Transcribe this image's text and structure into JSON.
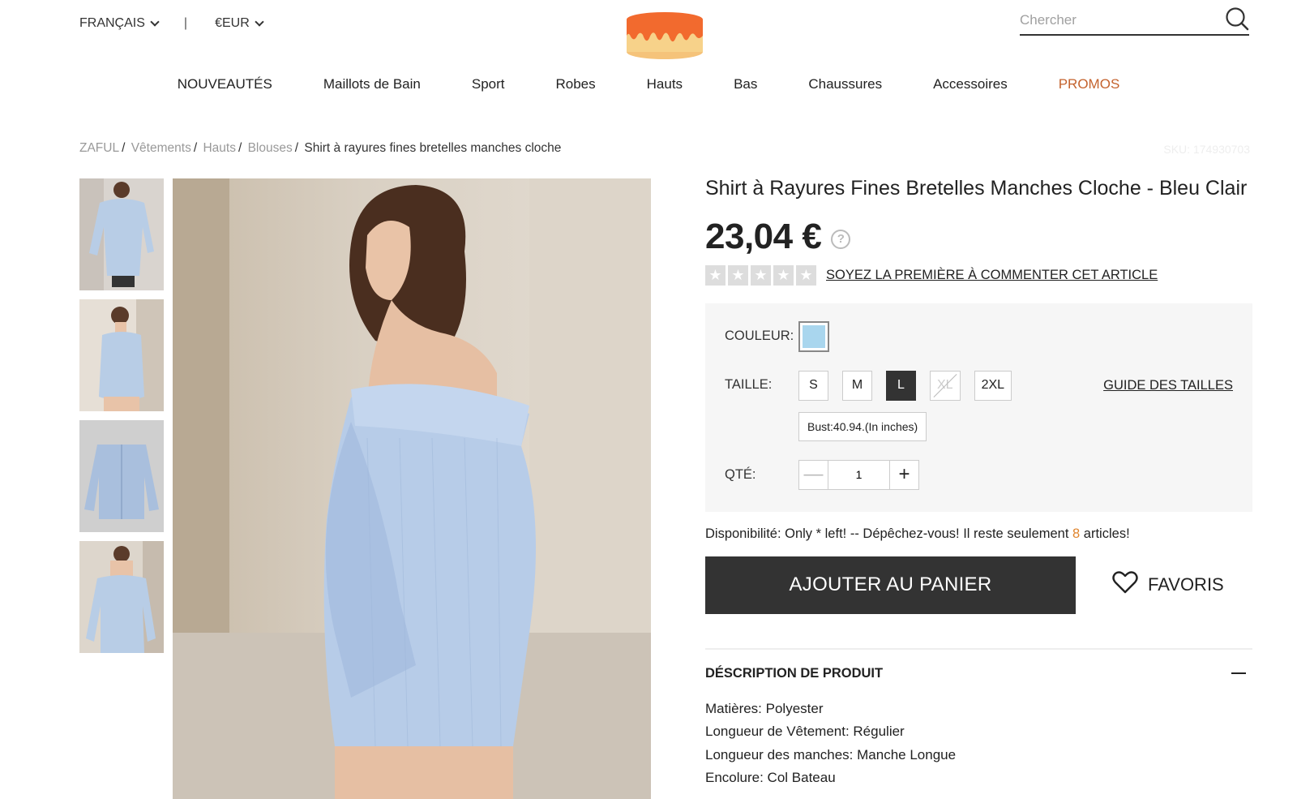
{
  "header": {
    "language_label": "FRANÇAIS",
    "separator": "|",
    "currency_label": "€EUR",
    "search_placeholder": "Chercher"
  },
  "nav": {
    "items": [
      {
        "label": "NOUVEAUTÉS"
      },
      {
        "label": "Maillots de Bain"
      },
      {
        "label": "Sport"
      },
      {
        "label": "Robes"
      },
      {
        "label": "Hauts"
      },
      {
        "label": "Bas"
      },
      {
        "label": "Chaussures"
      },
      {
        "label": "Accessoires"
      },
      {
        "label": "PROMOS",
        "color": "#c4622d"
      }
    ]
  },
  "breadcrumb": {
    "items": [
      "ZAFUL",
      "Vêtements",
      "Hauts",
      "Blouses"
    ],
    "current": "Shirt à rayures fines bretelles manches cloche",
    "sku": "SKU: 174930703"
  },
  "product": {
    "title": "Shirt à Rayures Fines Bretelles Manches Cloche - Bleu Clair",
    "price": "23,04 €",
    "help_icon_text": "?",
    "rating": {
      "stars": 0,
      "max": 5,
      "link_text": "SOYEZ LA PREMIÈRE À COMMENTER CET ARTICLE"
    },
    "color_label": "COULEUR:",
    "color_value": "#a9d6ee",
    "size_label": "TAILLE:",
    "sizes": [
      {
        "label": "S",
        "state": "normal"
      },
      {
        "label": "M",
        "state": "normal"
      },
      {
        "label": "L",
        "state": "selected"
      },
      {
        "label": "XL",
        "state": "disabled"
      },
      {
        "label": "2XL",
        "state": "normal"
      }
    ],
    "size_guide_label": "GUIDE DES TAILLES",
    "bust_info": "Bust:40.94.(In inches)",
    "qty_label": "QTÉ:",
    "qty_value": "1",
    "qty_minus": "—",
    "qty_plus": "+",
    "availability_prefix": "Disponibilité: Only * left! -- Dépêchez-vous! Il reste seulement ",
    "availability_count": "8",
    "availability_suffix": " articles!",
    "add_to_cart_label": "AJOUTER AU PANIER",
    "favorites_label": "FAVORIS"
  },
  "description": {
    "title": "DÉSCRIPTION DE PRODUIT",
    "lines": [
      "Matières: Polyester",
      "Longueur de Vêtement: Régulier",
      "Longueur des manches: Manche Longue",
      "Encolure: Col Bateau"
    ]
  },
  "colors": {
    "accent": "#c4622d",
    "cta_bg": "#333333",
    "stock_count": "#e0842c",
    "logo_icing": "#f26a2e",
    "logo_cake": "#f7d28a"
  }
}
